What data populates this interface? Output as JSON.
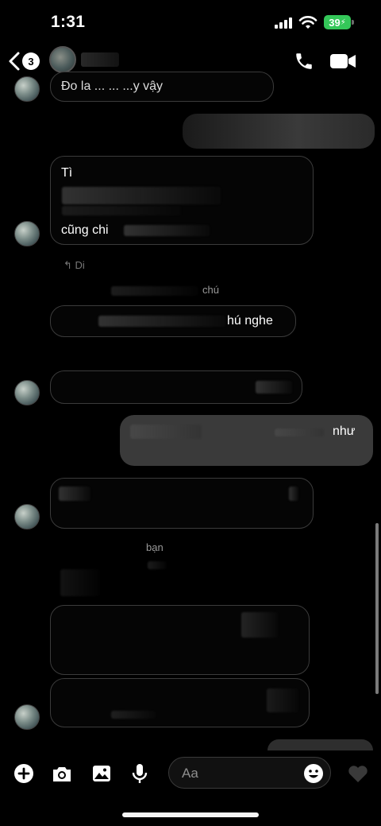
{
  "status": {
    "time": "1:31",
    "battery": "39"
  },
  "header": {
    "back_count": "3"
  },
  "messages": {
    "m1_text": "Đo la ... ... ...y vậy",
    "m2_line1": "Tì",
    "m2_line3": "cũng chi",
    "reply_label": "Di",
    "reply_snippet": "chú",
    "m3_text": "hú nghe",
    "m5_text": "như",
    "reply2_label": "bạn"
  },
  "composer": {
    "placeholder": "Aa"
  },
  "icons": {
    "back": "chevron-left-icon",
    "call": "phone-icon",
    "video": "video-camera-icon",
    "add": "plus-circle-icon",
    "camera": "camera-icon",
    "gallery": "image-icon",
    "mic": "microphone-icon",
    "emoji": "emoji-icon",
    "like": "heart-icon"
  },
  "colors": {
    "background": "#000000",
    "incoming_border": "#3b3b3b",
    "outgoing_bubble": "#3a3a3a",
    "battery": "#34c759"
  }
}
